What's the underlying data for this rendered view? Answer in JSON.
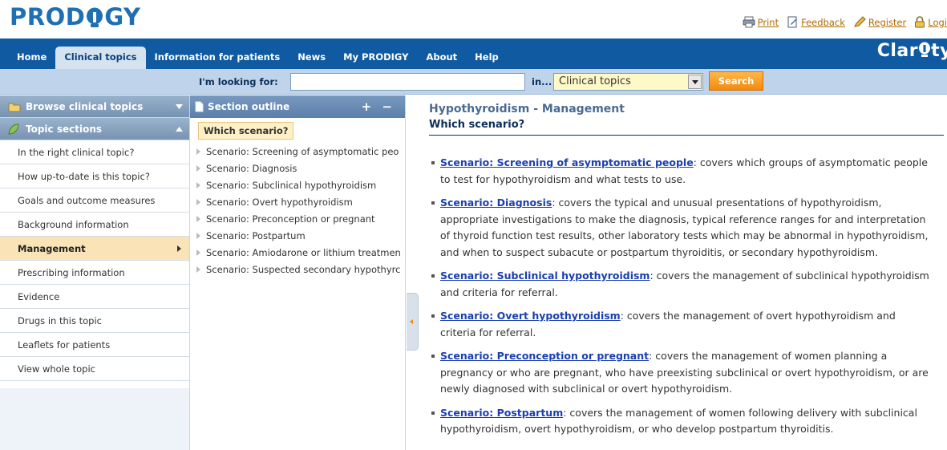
{
  "header": {
    "logo": {
      "left": "PROD",
      "right": "GY"
    },
    "utility_links": [
      {
        "label": "Print",
        "icon": "printer-icon"
      },
      {
        "label": "Feedback",
        "icon": "feedback-icon"
      },
      {
        "label": "Register",
        "icon": "pencil-icon"
      },
      {
        "label": "Logi",
        "icon": "lock-icon"
      }
    ]
  },
  "nav": {
    "tabs": [
      {
        "label": "Home",
        "active": false
      },
      {
        "label": "Clinical topics",
        "active": true
      },
      {
        "label": "Information for patients",
        "active": false
      },
      {
        "label": "News",
        "active": false
      },
      {
        "label": "My PRODIGY",
        "active": false
      },
      {
        "label": "About",
        "active": false
      },
      {
        "label": "Help",
        "active": false
      }
    ],
    "brand": {
      "left": "Clar",
      "right": "ty"
    }
  },
  "search": {
    "label": "I'm looking for:",
    "value": "",
    "in_label": "in...",
    "scope": "Clinical topics",
    "button": "Search"
  },
  "left_panel": {
    "browse_title": "Browse clinical topics",
    "sections_title": "Topic sections",
    "items": [
      {
        "label": "In the right clinical topic?",
        "active": false
      },
      {
        "label": "How up-to-date is this topic?",
        "active": false
      },
      {
        "label": "Goals and outcome measures",
        "active": false
      },
      {
        "label": "Background information",
        "active": false
      },
      {
        "label": "Management",
        "active": true
      },
      {
        "label": "Prescribing information",
        "active": false
      },
      {
        "label": "Evidence",
        "active": false
      },
      {
        "label": "Drugs in this topic",
        "active": false
      },
      {
        "label": "Leaflets for patients",
        "active": false
      },
      {
        "label": "View whole topic",
        "active": false
      }
    ]
  },
  "outline": {
    "title": "Section outline",
    "controls": "+ −",
    "current": "Which scenario?",
    "items": [
      "Scenario: Screening of asymptomatic peo",
      "Scenario: Diagnosis",
      "Scenario: Subclinical hypothyroidism",
      "Scenario: Overt hypothyroidism",
      "Scenario: Preconception or pregnant",
      "Scenario: Postpartum",
      "Scenario: Amiodarone or lithium treatmen",
      "Scenario: Suspected secondary hypothyrc"
    ]
  },
  "content": {
    "title": "Hypothyroidism - Management",
    "subtitle": "Which scenario?",
    "scenarios": [
      {
        "link": "Scenario: Screening of asymptomatic people",
        "text": ": covers which groups of asymptomatic people to test for hypothyroidism and what tests to use."
      },
      {
        "link": "Scenario: Diagnosis",
        "text": ": covers the typical and unusual presentations of hypothyroidism, appropriate investigations to make the diagnosis, typical reference ranges for and interpretation of thyroid function test results, other laboratory tests which may be abnormal in hypothyroidism, and when to suspect subacute or postpartum thyroiditis, or secondary hypothyroidism."
      },
      {
        "link": "Scenario: Subclinical hypothyroidism",
        "text": ": covers the management of subclinical hypothyroidism and criteria for referral."
      },
      {
        "link": "Scenario: Overt hypothyroidism",
        "text": ": covers the management of overt hypothyroidism and criteria for referral."
      },
      {
        "link": "Scenario: Preconception or pregnant",
        "text": ": covers the management of women planning a pregnancy or who are pregnant, who have preexisting subclinical or overt hypothyroidism, or are newly diagnosed with subclinical or overt hypothyroidism."
      },
      {
        "link": "Scenario: Postpartum",
        "text": ": covers the management of women following delivery with subclinical hypothyroidism, overt hypothyroidism, or who develop postpartum thyroiditis."
      }
    ]
  },
  "colors": {
    "brand_blue": "#1f6fb5",
    "nav_blue": "#0f5aa0",
    "accent_orange": "#f08a10",
    "link_blue": "#1a3fb0",
    "active_highlight": "#fbe3b8"
  }
}
